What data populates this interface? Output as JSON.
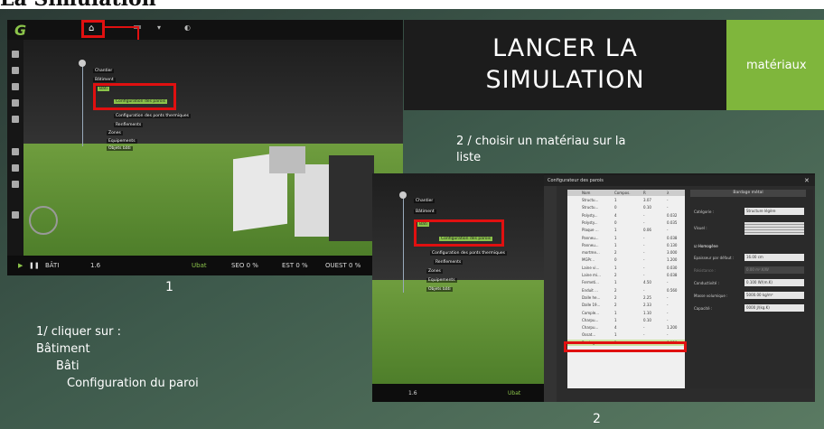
{
  "page_title": "La Simulation",
  "title_panel": {
    "line1": "LANCER LA",
    "line2": "SIMULATION"
  },
  "materials_tab": {
    "label": "matériaux"
  },
  "step2_text": {
    "line1": "2 / choisir un matériau sur la",
    "line2": "liste"
  },
  "instructions": {
    "line1": "1/ cliquer sur :",
    "line2": "Bâtiment",
    "line3": "Bâti",
    "line4": "Configuration du paroi"
  },
  "labels": {
    "one": "1",
    "two": "2"
  },
  "shot1": {
    "bottom": {
      "play": "▶",
      "pause": "❚❚",
      "bati": "BÂTI",
      "scale": "1.6",
      "ubat": "Ubat",
      "sud": "SEO 0 %",
      "est": "EST 0 %",
      "ouest": "OUEST 0 %"
    },
    "tree": [
      "Chantier",
      "Bâtiment",
      "Bâti",
      "Configuration des parois",
      "Configuration des ponts thermiques",
      "Renflements",
      "Zones",
      "Equipements",
      "Objets bâti"
    ]
  },
  "shot2": {
    "window_title": "Configurateur des parois",
    "table_headers": [
      "Nom",
      "Compos.",
      "R",
      "λ"
    ],
    "table_rows": [
      [
        "Structu...",
        "1",
        "3.07",
        "-"
      ],
      [
        "Structu...",
        "0",
        "0.10",
        "-"
      ],
      [
        "Polysty...",
        "4",
        "-",
        "0.032"
      ],
      [
        "Polysty...",
        "0",
        "-",
        "0.035"
      ],
      [
        "Plaque ...",
        "1",
        "0.06",
        "-"
      ],
      [
        "Panneu...",
        "1",
        "-",
        "0.038"
      ],
      [
        "Panneu...",
        "1",
        "-",
        "0.130"
      ],
      [
        "mortme...",
        "2",
        "-",
        "3.000"
      ],
      [
        "MGPr...",
        "0",
        "-",
        "1.200"
      ],
      [
        "Laine vi...",
        "1",
        "-",
        "0.030"
      ],
      [
        "Laine mi...",
        "2",
        "-",
        "0.038"
      ],
      [
        "Fermeti...",
        "1",
        "4.50",
        "-"
      ],
      [
        "Enduit ...",
        "2",
        "-",
        "0.560"
      ],
      [
        "Dalle he...",
        "2",
        "2.25",
        "-"
      ],
      [
        "Dalle 19...",
        "2",
        "2.33",
        "-"
      ],
      [
        "Comple...",
        "1",
        "1.10",
        "-"
      ],
      [
        "Charpu...",
        "1",
        "0.10",
        "-"
      ],
      [
        "Charpu...",
        "4",
        "-",
        "1.200"
      ],
      [
        "Ossat...",
        "1",
        "-",
        "-"
      ],
      [
        "Bardag...",
        "1",
        "-",
        "0.130"
      ]
    ],
    "props_title": "Bardage métal",
    "fields": {
      "categorie_label": "Catégorie :",
      "categorie_value": "Structure légère",
      "visuel_label": "Visuel :",
      "homogene_label": "Homogène",
      "epaisseur_label": "Epaisseur par défaut :",
      "epaisseur_value": "16.00 cm",
      "resistance_label": "Résistance :",
      "resistance_value": "0.00 m².K/W",
      "conductivite_label": "Conductivité :",
      "conductivite_value": "0.100 W/(m.K)",
      "masse_label": "Masse volumique :",
      "masse_value": "5000.00 kg/m³",
      "capacite_label": "Capacité :",
      "capacite_value": "0000 J/(kg.K)"
    },
    "bottom": {
      "scale": "1.6",
      "ubat": "Ubat"
    },
    "tree": [
      "Chantier",
      "Bâtiment",
      "Bâti",
      "Configuration des parois",
      "Configuration des ponts thermiques",
      "Renflements",
      "Zones",
      "Equipements",
      "Objets bâti"
    ]
  },
  "colors": {
    "accent_green": "#7fb63c",
    "highlight_red": "#e01010",
    "tree_green": "#8bc34a"
  }
}
